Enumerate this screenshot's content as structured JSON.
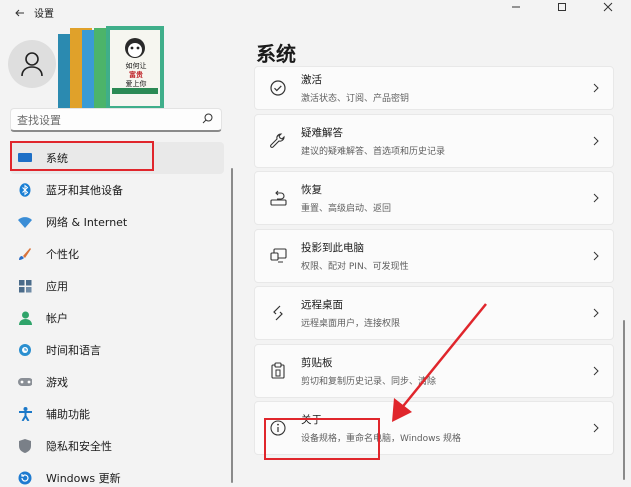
{
  "window": {
    "title": "设置"
  },
  "search": {
    "placeholder": "查找设置"
  },
  "sidebar": {
    "items": [
      {
        "label": "系统"
      },
      {
        "label": "蓝牙和其他设备"
      },
      {
        "label": "网络 & Internet"
      },
      {
        "label": "个性化"
      },
      {
        "label": "应用"
      },
      {
        "label": "帐户"
      },
      {
        "label": "时间和语言"
      },
      {
        "label": "游戏"
      },
      {
        "label": "辅助功能"
      },
      {
        "label": "隐私和安全性"
      },
      {
        "label": "Windows 更新"
      }
    ]
  },
  "main": {
    "title": "系统",
    "cards": [
      {
        "title": "激活",
        "subtitle": "激活状态、订阅、产品密钥"
      },
      {
        "title": "疑难解答",
        "subtitle": "建议的疑难解答、首选项和历史记录"
      },
      {
        "title": "恢复",
        "subtitle": "重置、高级启动、返回"
      },
      {
        "title": "投影到此电脑",
        "subtitle": "权限、配对 PIN、可发现性"
      },
      {
        "title": "远程桌面",
        "subtitle": "远程桌面用户，连接权限"
      },
      {
        "title": "剪贴板",
        "subtitle": "剪切和复制历史记录、同步、清除"
      },
      {
        "title": "关于",
        "subtitle": "设备规格，重命名电脑，Windows 规格"
      }
    ]
  },
  "book_cover_text": {
    "line1": "如何让",
    "line2": "富贵",
    "line3": "爱上你"
  },
  "colors": {
    "annotation": "#e0262c",
    "accent": "#0067c0"
  }
}
